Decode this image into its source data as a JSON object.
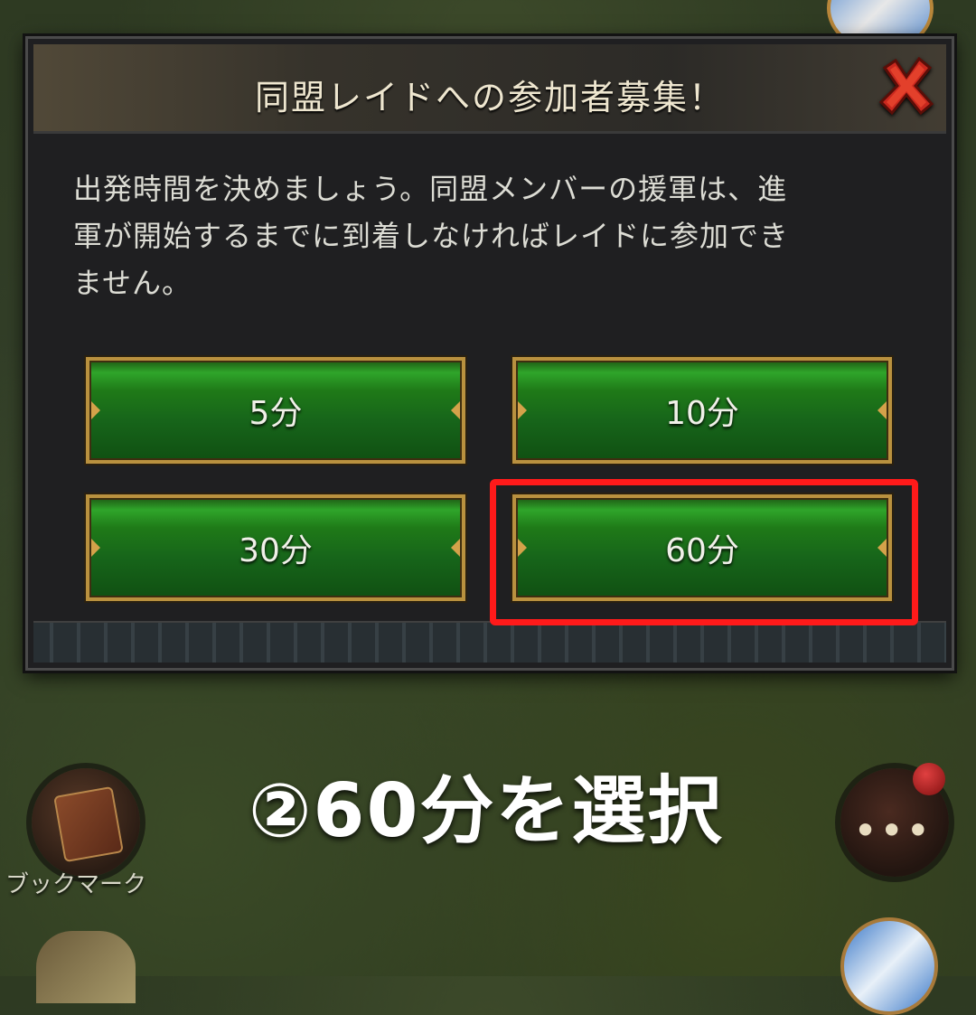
{
  "dialog": {
    "title": "同盟レイドへの参加者募集！",
    "body_lines": [
      "出発時間を決めましょう。同盟メンバーの援軍は、進",
      "軍が開始するまでに到着しなければレイドに参加でき",
      "ません。"
    ],
    "close_icon": "close-x-icon",
    "options": [
      {
        "label": "5分"
      },
      {
        "label": "10分"
      },
      {
        "label": "30分"
      },
      {
        "label": "60分"
      }
    ],
    "selected_option": "60分"
  },
  "annotation": {
    "instruction": "②60分を選択",
    "highlight_color": "#ff1a1a"
  },
  "background": {
    "bookmark_label": "ブックマーク",
    "more_icon": "more-dots-icon"
  },
  "colors": {
    "button_green": "#1f7a18",
    "button_border_gold": "#b9913f",
    "dialog_bg": "#1f1f21"
  }
}
